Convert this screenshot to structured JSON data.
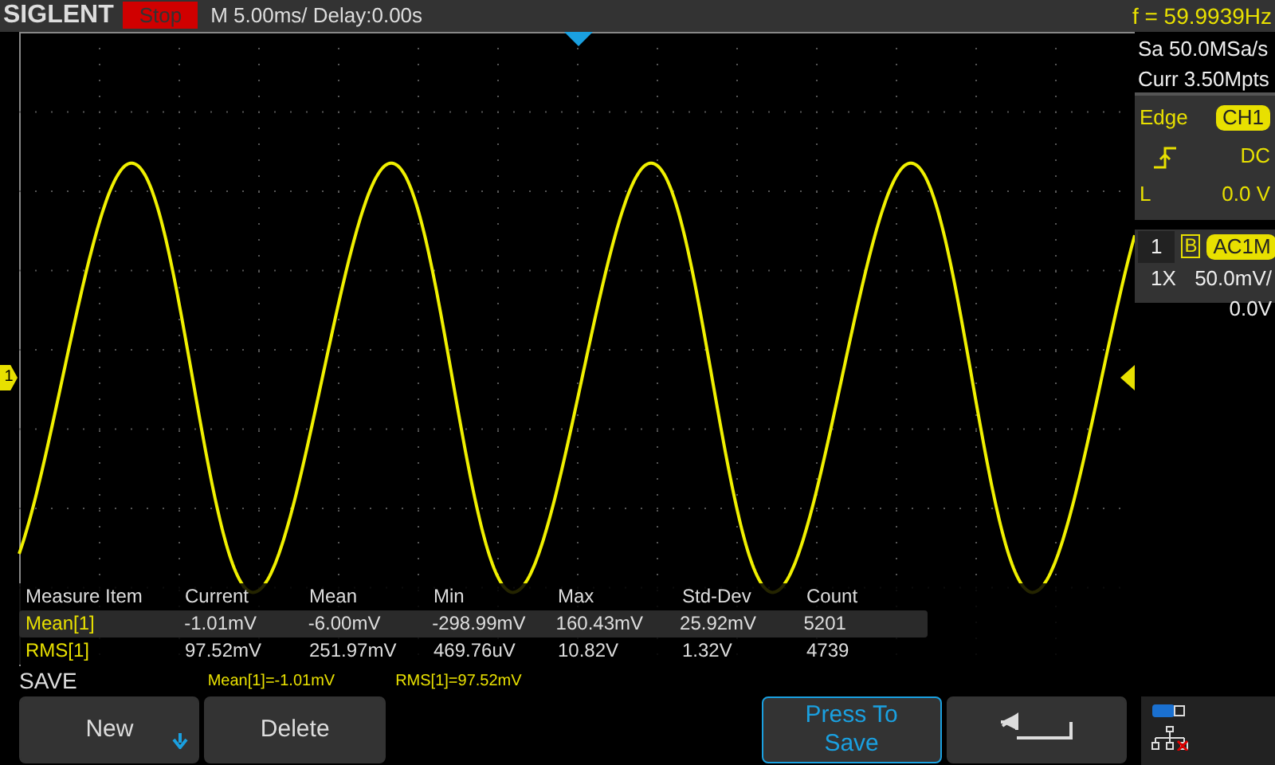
{
  "header": {
    "logo": "SIGLENT",
    "run_state": "Stop",
    "timebase": "M 5.00ms/ Delay:0.00s",
    "frequency": "f = 59.9939Hz"
  },
  "acquisition": {
    "sample_rate": "Sa 50.0MSa/s",
    "memory": "Curr 3.50Mpts"
  },
  "trigger": {
    "type": "Edge",
    "source": "CH1",
    "coupling": "DC",
    "level_label": "L",
    "level_value": "0.0 V"
  },
  "channel": {
    "number": "1",
    "bandwidth": "B",
    "coupling": "AC1M",
    "probe": "1X",
    "scale": "50.0mV/",
    "offset": "0.0V"
  },
  "channel_marker": "1",
  "measurements": {
    "columns": [
      "Measure Item",
      "Current",
      "Mean",
      "Min",
      "Max",
      "Std-Dev",
      "Count"
    ],
    "rows": [
      {
        "selected": true,
        "cells": [
          "Mean[1]",
          "-1.01mV",
          "-6.00mV",
          "-298.99mV",
          "160.43mV",
          "25.92mV",
          "5201"
        ]
      },
      {
        "selected": false,
        "cells": [
          "RMS[1]",
          "97.52mV",
          "251.97mV",
          "469.76uV",
          "10.82V",
          "1.32V",
          "4739"
        ]
      }
    ]
  },
  "menu_title": "SAVE",
  "readouts": [
    "Mean[1]=-1.01mV",
    "RMS[1]=97.52mV"
  ],
  "softkeys": [
    {
      "kind": "dropdown",
      "label": "New",
      "highlighted": false
    },
    {
      "kind": "plain",
      "label": "Delete",
      "highlighted": false
    },
    {
      "kind": "blank"
    },
    {
      "kind": "blank"
    },
    {
      "kind": "plain",
      "label": "Press To Save",
      "highlighted": true
    },
    {
      "kind": "back",
      "highlighted": false
    }
  ]
}
